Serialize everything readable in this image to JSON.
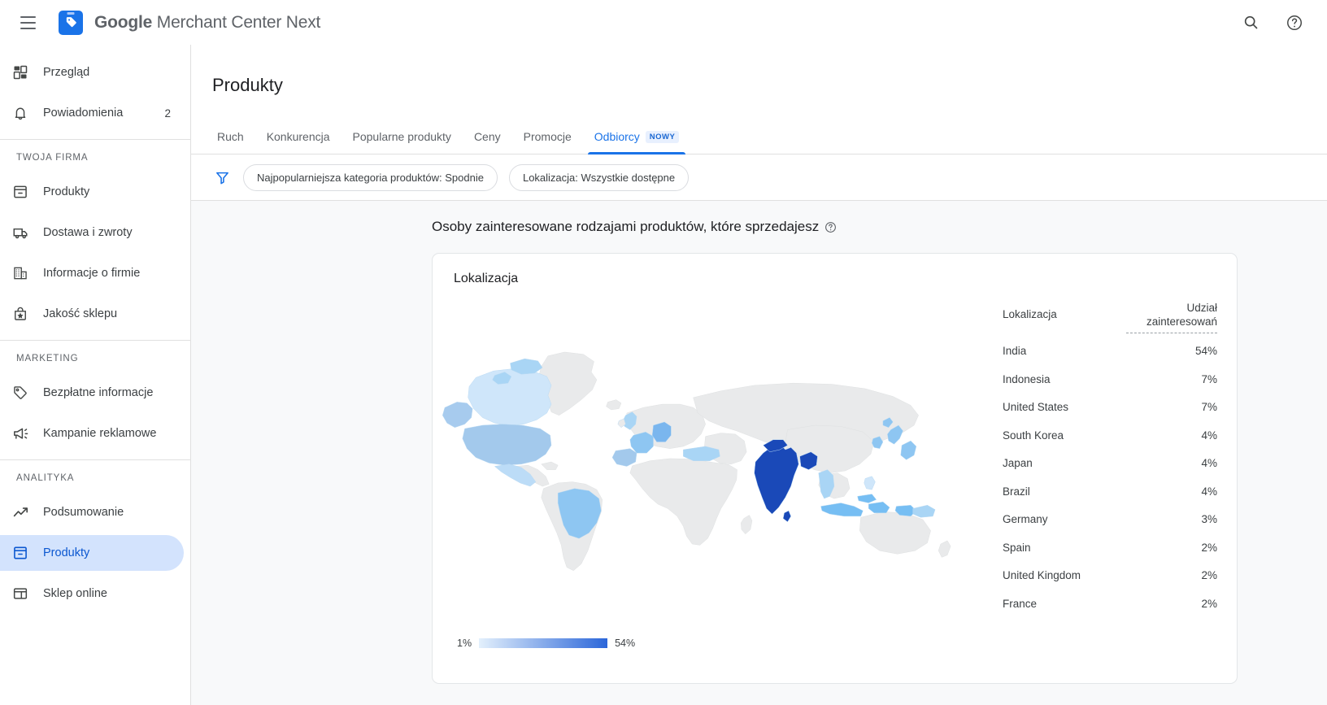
{
  "topbar": {
    "menu_icon": "hamburger-icon",
    "logo_icon": "merchant-center-logo",
    "brand_prefix": "Google",
    "brand_suffix": " Merchant Center Next",
    "search_icon": "search-icon",
    "help_icon": "help-circle-icon"
  },
  "sidebar": {
    "items": [
      {
        "label": "Przegląd",
        "icon": "dashboard-icon",
        "badge": ""
      },
      {
        "label": "Powiadomienia",
        "icon": "bell-icon",
        "badge": "2"
      }
    ],
    "sections": [
      {
        "title": "TWOJA FIRMA",
        "items": [
          {
            "label": "Produkty",
            "icon": "inventory-icon"
          },
          {
            "label": "Dostawa i zwroty",
            "icon": "truck-icon"
          },
          {
            "label": "Informacje o firmie",
            "icon": "building-icon"
          },
          {
            "label": "Jakość sklepu",
            "icon": "store-quality-icon"
          }
        ]
      },
      {
        "title": "MARKETING",
        "items": [
          {
            "label": "Bezpłatne informacje",
            "icon": "tag-icon"
          },
          {
            "label": "Kampanie reklamowe",
            "icon": "campaign-icon"
          }
        ]
      },
      {
        "title": "ANALITYKA",
        "items": [
          {
            "label": "Podsumowanie",
            "icon": "trending-up-icon"
          },
          {
            "label": "Produkty",
            "icon": "inventory-icon",
            "active": true
          },
          {
            "label": "Sklep online",
            "icon": "web-store-icon"
          }
        ]
      }
    ]
  },
  "page": {
    "title": "Produkty",
    "tabs": [
      {
        "label": "Ruch"
      },
      {
        "label": "Konkurencja"
      },
      {
        "label": "Popularne produkty"
      },
      {
        "label": "Ceny"
      },
      {
        "label": "Promocje"
      },
      {
        "label": "Odbiorcy",
        "badge": "NOWY",
        "active": true
      }
    ],
    "filter_icon": "filter-funnel-icon",
    "chips": [
      "Najpopularniejsza kategoria produktów: Spodnie",
      "Lokalizacja: Wszystkie dostępne"
    ],
    "section_heading": "Osoby zainteresowane rodzajami produktów, które sprzedajesz",
    "section_help_icon": "help-circle-icon"
  },
  "card": {
    "title": "Lokalizacja",
    "legend_min": "1%",
    "legend_max": "54%",
    "columns": {
      "location": "Lokalizacja",
      "share": "Udział\nzainteresowań",
      "share_line1": "Udział",
      "share_line2": "zainteresowań"
    }
  },
  "chart_data": {
    "type": "table",
    "title": "Lokalizacja",
    "xlabel": "Lokalizacja",
    "ylabel": "Udział zainteresowań",
    "legend_range": [
      1,
      54
    ],
    "unit": "%",
    "color_scale_low": "#e3f0fc",
    "color_scale_high": "#1a49b8",
    "categories": [
      "India",
      "Indonesia",
      "United States",
      "South Korea",
      "Japan",
      "Brazil",
      "Germany",
      "Spain",
      "United Kingdom",
      "France"
    ],
    "values": [
      54,
      7,
      7,
      4,
      4,
      4,
      3,
      2,
      2,
      2
    ],
    "rows": [
      {
        "location": "India",
        "share": "54%"
      },
      {
        "location": "Indonesia",
        "share": "7%"
      },
      {
        "location": "United States",
        "share": "7%"
      },
      {
        "location": "South Korea",
        "share": "4%"
      },
      {
        "location": "Japan",
        "share": "4%"
      },
      {
        "location": "Brazil",
        "share": "4%"
      },
      {
        "location": "Germany",
        "share": "3%"
      },
      {
        "location": "Spain",
        "share": "2%"
      },
      {
        "location": "United Kingdom",
        "share": "2%"
      },
      {
        "location": "France",
        "share": "2%"
      }
    ]
  },
  "colors": {
    "accent": "#1a73e8",
    "active_nav_bg": "#d3e3fd",
    "active_nav_fg": "#0b57d0",
    "map_inactive": "#ebecec",
    "panel_bg": "#f8f9fa"
  }
}
